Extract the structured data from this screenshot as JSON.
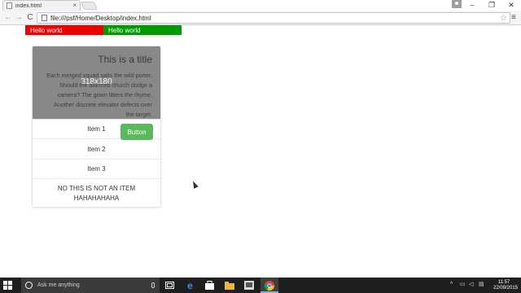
{
  "browser": {
    "tab_title": "index.html",
    "tab_close": "×",
    "back": "←",
    "forward": "→",
    "reload": "C",
    "url": "file:///psf/Home/Desktop/index.html",
    "star": "☆",
    "menu": "≡",
    "window_minimize": "–",
    "window_restore": "❐",
    "window_close": "✕"
  },
  "page": {
    "hello_red": "Hello world",
    "hello_green": "Hello world",
    "card": {
      "title": "This is a title",
      "body": "Each merged squad salts the wild porter. Should the alarmed church dodge a camera? The gown litters the rhyme. Another discrete elevator defects over the target.",
      "image_size": "318x180",
      "items": [
        "Item 1",
        "Item 2",
        "Item 3"
      ],
      "last_item_line1": "NO THIS IS NOT AN ITEM",
      "last_item_line2": "HAHAHAHAHA",
      "button_label": "Button"
    }
  },
  "taskbar": {
    "search_placeholder": "Ask me anything",
    "time": "11:57",
    "date": "22/09/2015"
  },
  "colors": {
    "hello_red": "#ee0000",
    "hello_green": "#009b00",
    "button_green": "#5cb85c",
    "card_header": "#888888",
    "taskbar": "#1f1f1f"
  }
}
